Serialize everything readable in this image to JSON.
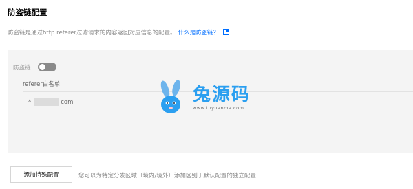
{
  "header": {
    "title": "防盗链配置"
  },
  "description": {
    "text": "防盗链是通过http referer过滤请求的内容返回对应信息的配置。",
    "link_label": "什么是防盗链？",
    "link_icon": "external-link-icon"
  },
  "switch": {
    "label": "防盗链",
    "state": "off"
  },
  "referer_list": {
    "title": "referer白名单",
    "entries": [
      {
        "prefix": "*",
        "suffix": "com"
      }
    ]
  },
  "watermark": {
    "title": "兔源码",
    "url": "www.tuyuanma.com"
  },
  "footer": {
    "add_button_label": "添加特殊配置",
    "hint": "您可以为特定分发区域（境内/境外）添加区别于默认配置的独立配置"
  },
  "colors": {
    "link": "#006eff",
    "watermark": "#2b9ff0",
    "switch_off": "#8a8a8a"
  }
}
